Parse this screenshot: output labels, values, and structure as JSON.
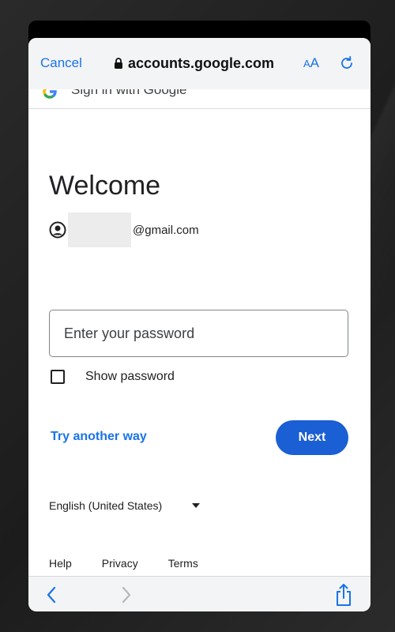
{
  "header": {
    "cancel_label": "Cancel",
    "url": "accounts.google.com",
    "aa_small": "A",
    "aa_big": "A"
  },
  "banner": {
    "text": "Sign in with Google"
  },
  "signin": {
    "title": "Welcome",
    "email_suffix": "@gmail.com",
    "password_placeholder": "Enter your password",
    "show_password_label": "Show password",
    "try_another_way": "Try another way",
    "next_label": "Next"
  },
  "footer": {
    "language": "English (United States)",
    "links": [
      "Help",
      "Privacy",
      "Terms"
    ]
  },
  "icons": {
    "lock": "lock-icon",
    "reload": "reload-icon",
    "account": "account-circle-icon",
    "caret": "caret-down-icon",
    "back": "chevron-left-icon",
    "forward": "chevron-right-icon",
    "share": "share-icon"
  },
  "colors": {
    "accent": "#1a73e8",
    "primary_button": "#1a5fd3"
  }
}
